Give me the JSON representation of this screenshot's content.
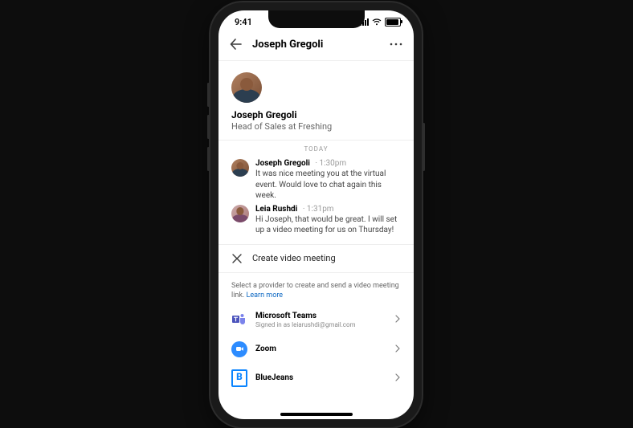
{
  "status": {
    "time": "9:41"
  },
  "header": {
    "title": "Joseph Gregoli"
  },
  "profile": {
    "name": "Joseph Gregoli",
    "role": "Head of Sales at Freshing"
  },
  "chat": {
    "date_label": "TODAY",
    "messages": [
      {
        "sender": "Joseph Gregoli",
        "time": "1:30pm",
        "text": "It was nice meeting you at the virtual event. Would love to chat again this week."
      },
      {
        "sender": "Leia Rushdi",
        "time": "1:31pm",
        "text": "Hi Joseph, that would be great. I will set up a video meeting for us on Thursday!"
      }
    ]
  },
  "panel": {
    "title": "Create video meeting",
    "description": "Select a provider to create and send a video meeting link.",
    "learn_more": "Learn more",
    "providers": [
      {
        "name": "Microsoft Teams",
        "sub": "Signed in as leiarushdi@gmail.com"
      },
      {
        "name": "Zoom",
        "sub": ""
      },
      {
        "name": "BlueJeans",
        "sub": ""
      }
    ]
  }
}
